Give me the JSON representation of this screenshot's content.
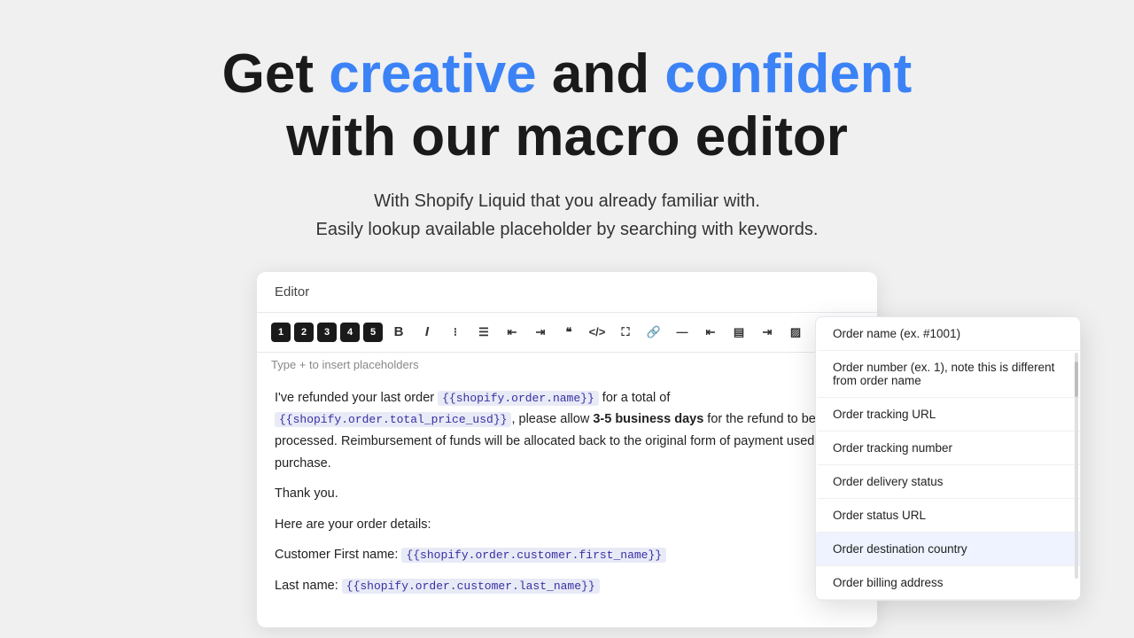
{
  "hero": {
    "title_start": "Get ",
    "title_blue1": "creative",
    "title_middle": " and ",
    "title_blue2": "confident",
    "title_end": "",
    "title_line2": "with our macro editor",
    "subtitle_line1": "With Shopify Liquid that you already familiar with.",
    "subtitle_line2": "Easily lookup available placeholder by searching with keywords."
  },
  "editor": {
    "header_label": "Editor",
    "toolbar": {
      "h1": "1",
      "h2": "2",
      "h3": "3",
      "h4": "4",
      "h5": "5",
      "bold": "B",
      "italic": "I",
      "placeholder_hint": "Type + to insert placeholders"
    },
    "content": {
      "line1_prefix": "I've refunded your last order ",
      "line1_tag1": "{{shopify.order.name}}",
      "line1_middle": " for a total of ",
      "line1_tag2": "{{shopify.order.total_price_usd}}",
      "line1_suffix": ", please allow ",
      "line1_bold": "3-5 business days",
      "line1_rest": " for the refund to be processed. Reimbursement of funds will be allocated back to the original form of payment used for purchase.",
      "line2": "Thank you.",
      "line3": "Here are your order details:",
      "line4_prefix": "Customer First name:",
      "line4_tag": "{{shopify.order.customer.first_name}}",
      "line5_prefix": "Last name:",
      "line5_tag": "{{shopify.order.customer.last_name}}"
    }
  },
  "dropdown": {
    "search_placeholder": "",
    "items": [
      {
        "label": "Order name (ex. #1001)",
        "active": false
      },
      {
        "label": "Order number (ex. 1), note this is different from order name",
        "active": false
      },
      {
        "label": "Order tracking URL",
        "active": false
      },
      {
        "label": "Order tracking number",
        "active": false
      },
      {
        "label": "Order delivery status",
        "active": false
      },
      {
        "label": "Order status URL",
        "active": false
      },
      {
        "label": "Order destination country",
        "active": true
      },
      {
        "label": "Order billing address",
        "active": false
      }
    ]
  }
}
